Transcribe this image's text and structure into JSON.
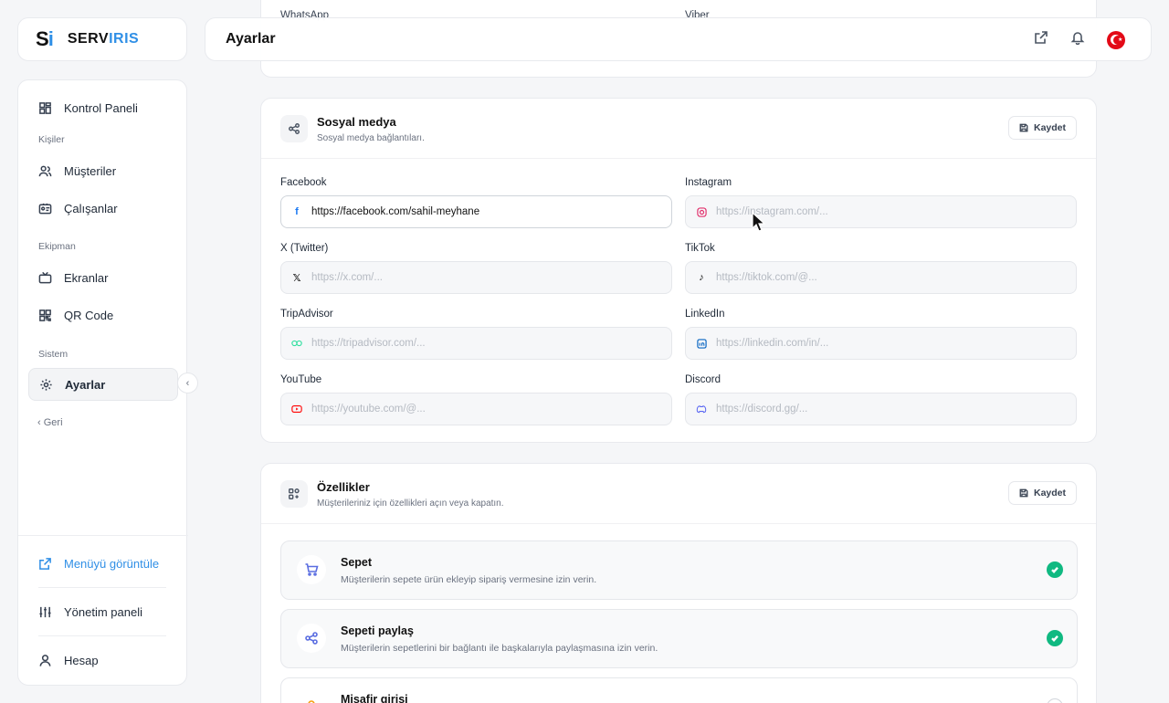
{
  "brand": {
    "mark_s": "S",
    "mark_i": "i",
    "name_a": "SERV",
    "name_b": "IRIS"
  },
  "header": {
    "title": "Ayarlar"
  },
  "sidebar": {
    "dashboard": "Kontrol Paneli",
    "section_people": "Kişiler",
    "customers": "Müşteriler",
    "employees": "Çalışanlar",
    "section_equipment": "Ekipman",
    "screens": "Ekranlar",
    "qr": "QR Code",
    "section_system": "Sistem",
    "settings": "Ayarlar",
    "back": "Geri",
    "view_menu": "Menüyü görüntüle",
    "admin": "Yönetim paneli",
    "account": "Hesap"
  },
  "ghost": {
    "whatsapp": "WhatsApp",
    "viber": "Viber"
  },
  "social": {
    "title": "Sosyal medya",
    "subtitle": "Sosyal medya bağlantıları.",
    "save": "Kaydet",
    "fields": {
      "facebook": {
        "label": "Facebook",
        "value": "https://facebook.com/sahil-meyhane",
        "placeholder": ""
      },
      "instagram": {
        "label": "Instagram",
        "value": "",
        "placeholder": "https://instagram.com/..."
      },
      "twitter": {
        "label": "X (Twitter)",
        "value": "",
        "placeholder": "https://x.com/..."
      },
      "tiktok": {
        "label": "TikTok",
        "value": "",
        "placeholder": "https://tiktok.com/@..."
      },
      "tripadvisor": {
        "label": "TripAdvisor",
        "value": "",
        "placeholder": "https://tripadvisor.com/..."
      },
      "linkedin": {
        "label": "LinkedIn",
        "value": "",
        "placeholder": "https://linkedin.com/in/..."
      },
      "youtube": {
        "label": "YouTube",
        "value": "",
        "placeholder": "https://youtube.com/@..."
      },
      "discord": {
        "label": "Discord",
        "value": "",
        "placeholder": "https://discord.gg/..."
      }
    }
  },
  "features": {
    "title": "Özellikler",
    "subtitle": "Müşterileriniz için özellikleri açın veya kapatın.",
    "save": "Kaydet",
    "items": [
      {
        "title": "Sepet",
        "desc": "Müşterilerin sepete ürün ekleyip sipariş vermesine izin verin.",
        "enabled": true
      },
      {
        "title": "Sepeti paylaş",
        "desc": "Müşterilerin sepetlerini bir bağlantı ile başkalarıyla paylaşmasına izin verin.",
        "enabled": true
      },
      {
        "title": "Misafir girişi",
        "desc": "",
        "enabled": false
      }
    ]
  },
  "colors": {
    "accent": "#2f8fe6",
    "success": "#10b981"
  }
}
